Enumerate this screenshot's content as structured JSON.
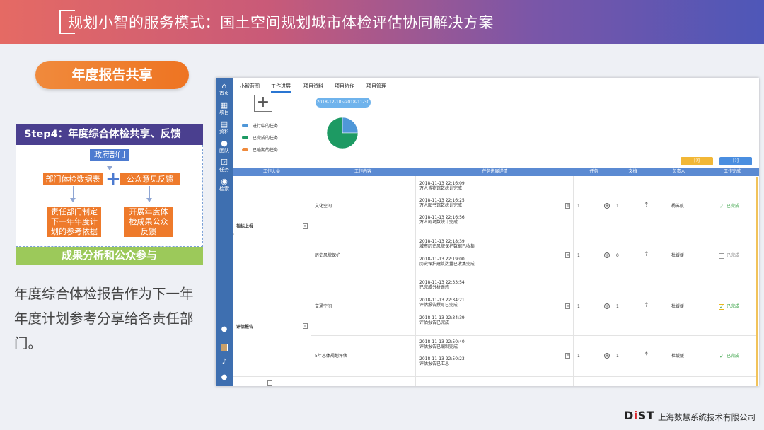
{
  "header": {
    "title": "规划小智的服务模式：国土空间规划城市体检评估协同解决方案"
  },
  "left": {
    "pill": "年度报告共享",
    "flow": {
      "title": "Step4：年度综合体检共享、反馈",
      "gov": "政府部门",
      "dept_data": "部门体检数据表",
      "public_feedback": "公众意见反馈",
      "resp_line1": "责任部门制定",
      "resp_line2": "下一年年度计",
      "resp_line3": "划的参考依据",
      "annual_line1": "开展年度体",
      "annual_line2": "检成果公众",
      "annual_line3": "反馈",
      "footer": "成果分析和公众参与"
    },
    "description": "年度综合体检报告作为下一年年度计划参考分享给各责任部门。"
  },
  "app": {
    "sidebar": [
      {
        "icon": "⌂",
        "label": "首页"
      },
      {
        "icon": "▦",
        "label": "项目"
      },
      {
        "icon": "▤",
        "label": "资料"
      },
      {
        "icon": "●",
        "label": "团队"
      },
      {
        "icon": "☑",
        "label": "任务"
      },
      {
        "icon": "◉",
        "label": "检索"
      }
    ],
    "sidebar_bottom_icons": [
      "user-icon",
      "avatar",
      "bell-icon",
      "help-icon"
    ],
    "tabs": [
      "小智蓝图",
      "工作进展",
      "项目资料",
      "项目协作",
      "项目管理"
    ],
    "active_tab": "工作进展",
    "date_range": "2018-12-10~2018-11-30",
    "legend": [
      {
        "label": "进行中的任务",
        "color": "#4f97d8"
      },
      {
        "label": "已完成的任务",
        "color": "#1d9a63"
      },
      {
        "label": "已逾期的任务",
        "color": "#ef8a3c"
      }
    ],
    "pie": [
      {
        "label": "进行中的任务",
        "value": 25,
        "color": "#4f97d8"
      },
      {
        "label": "已完成的任务",
        "value": 75,
        "color": "#1d9a63"
      }
    ],
    "buttons": {
      "export": "[?]",
      "add": "[?]"
    },
    "table_headers": [
      "工作大类",
      "工作内容",
      "任务进展详情",
      "任务",
      "文档",
      "负责人",
      "工作完成"
    ],
    "groups": [
      {
        "name": "指标上报"
      },
      {
        "name": "评估报告"
      }
    ],
    "rows": [
      {
        "content": "文化空间",
        "logs": [
          {
            "time": "2018-11-13 22:16:09",
            "text": "万人博物馆数统计完成"
          },
          {
            "time": "2018-11-13 22:16:25",
            "text": "万人图书馆数统计完成"
          },
          {
            "time": "2018-11-13 22:16:56",
            "text": "万人剧场数统计完成"
          }
        ],
        "tasks": "1",
        "docs": "1",
        "owner": "杨苏航",
        "done": true,
        "done_label": "已完成"
      },
      {
        "content": "历史风貌保护",
        "logs": [
          {
            "time": "2018-11-13 22:18:39",
            "text": "城市历史风貌保护数据已收集"
          },
          {
            "time": "2018-11-13 22:19:00",
            "text": "历史保护建筑数量已收集完成"
          }
        ],
        "tasks": "1",
        "docs": "0",
        "owner": "杜媛媛",
        "done": false,
        "done_label": "已完成"
      },
      {
        "content": "交通空间",
        "logs": [
          {
            "time": "2018-11-13 22:33:54",
            "text": "已完成分析遥感"
          },
          {
            "time": "2018-11-13 22:34:21",
            "text": "评估报告撰写已完成"
          },
          {
            "time": "2018-11-13 22:34:39",
            "text": "评估报告已完成"
          }
        ],
        "tasks": "1",
        "docs": "1",
        "owner": "杜媛媛",
        "done": true,
        "done_label": "已完成"
      },
      {
        "content": "5年总体规划评估",
        "logs": [
          {
            "time": "2018-11-13 22:50:40",
            "text": "评估报告已编制完成"
          },
          {
            "time": "2018-11-13 22:50:23",
            "text": "评估报告已汇总"
          }
        ],
        "tasks": "1",
        "docs": "1",
        "owner": "杜媛媛",
        "done": true,
        "done_label": "已完成"
      }
    ]
  },
  "footer": {
    "logo_d": "D",
    "logo_i": "i",
    "logo_st": "ST",
    "company": "上海数慧系统技术有限公司"
  }
}
